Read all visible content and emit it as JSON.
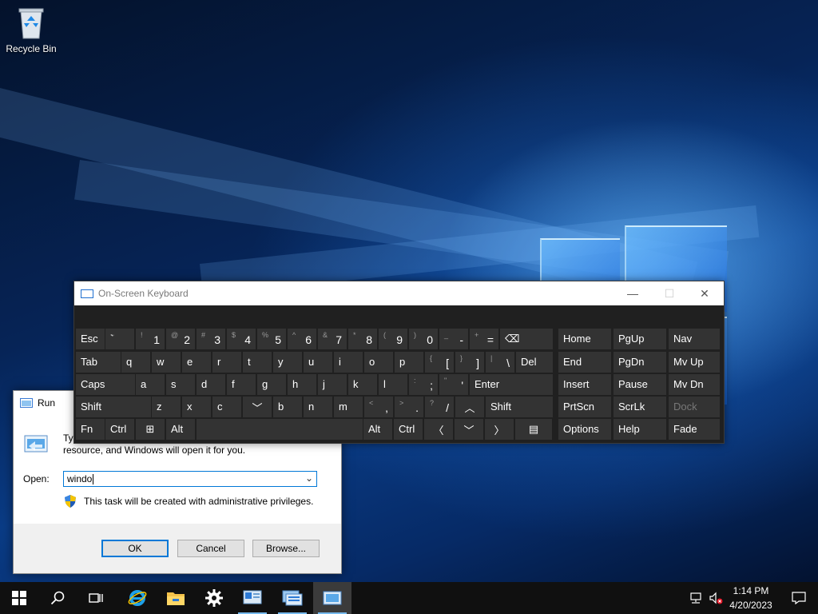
{
  "desktop": {
    "icons": [
      {
        "label": "Recycle Bin",
        "icon": "recycle-bin-icon"
      }
    ]
  },
  "run_dialog": {
    "title": "Run",
    "description": "Type the name of a program, folder, document, or Internet resource, and Windows will open it for you.",
    "description_visible_line1": "Typ",
    "description_line2": "resource, and Windows will open it for you.",
    "open_label": "Open:",
    "open_value": "windo",
    "admin_note": "This task will be created with administrative privileges.",
    "ok_label": "OK",
    "cancel_label": "Cancel",
    "browse_label": "Browse..."
  },
  "osk": {
    "title": "On-Screen Keyboard",
    "rows": [
      [
        {
          "main": "Esc"
        },
        {
          "sub": "~",
          "main": "`"
        },
        {
          "sub": "!",
          "big": "1"
        },
        {
          "sub": "@",
          "big": "2"
        },
        {
          "sub": "#",
          "big": "3"
        },
        {
          "sub": "$",
          "big": "4"
        },
        {
          "sub": "%",
          "big": "5"
        },
        {
          "sub": "^",
          "big": "6"
        },
        {
          "sub": "&",
          "big": "7"
        },
        {
          "sub": "*",
          "big": "8"
        },
        {
          "sub": "(",
          "big": "9"
        },
        {
          "sub": ")",
          "big": "0"
        },
        {
          "sub": "_",
          "big": "-"
        },
        {
          "sub": "+",
          "big": "="
        },
        {
          "main": "⌫"
        }
      ],
      [
        {
          "main": "Tab"
        },
        {
          "main": "q"
        },
        {
          "main": "w"
        },
        {
          "main": "e"
        },
        {
          "main": "r"
        },
        {
          "main": "t"
        },
        {
          "main": "y"
        },
        {
          "main": "u"
        },
        {
          "main": "i"
        },
        {
          "main": "o"
        },
        {
          "main": "p"
        },
        {
          "sub": "{",
          "big": "["
        },
        {
          "sub": "}",
          "big": "]"
        },
        {
          "sub": "|",
          "big": "\\"
        },
        {
          "main": "Del"
        }
      ],
      [
        {
          "main": "Caps"
        },
        {
          "main": "a"
        },
        {
          "main": "s"
        },
        {
          "main": "d"
        },
        {
          "main": "f"
        },
        {
          "main": "g"
        },
        {
          "main": "h"
        },
        {
          "main": "j"
        },
        {
          "main": "k"
        },
        {
          "main": "l"
        },
        {
          "sub": ":",
          "big": ";"
        },
        {
          "sub": "\"",
          "big": "'"
        },
        {
          "main": "Enter"
        }
      ],
      [
        {
          "main": "Shift"
        },
        {
          "main": "z"
        },
        {
          "main": "x"
        },
        {
          "main": "c"
        },
        {
          "main": "v"
        },
        {
          "main": "b"
        },
        {
          "main": "n"
        },
        {
          "main": "m"
        },
        {
          "sub": "<",
          "big": ","
        },
        {
          "sub": ">",
          "big": "."
        },
        {
          "sub": "?",
          "big": "/"
        },
        {
          "main": "^"
        },
        {
          "main": "Shift"
        }
      ],
      [
        {
          "main": "Fn"
        },
        {
          "main": "Ctrl"
        },
        {
          "main": "⊞"
        },
        {
          "main": "Alt"
        },
        {
          "main": ""
        },
        {
          "main": "Alt"
        },
        {
          "main": "Ctrl"
        },
        {
          "main": "<"
        },
        {
          "main": "v"
        },
        {
          "main": ">"
        },
        {
          "main": "▤"
        }
      ]
    ],
    "nav_rows": [
      [
        "Home",
        "PgUp",
        "Nav"
      ],
      [
        "End",
        "PgDn",
        "Mv Up"
      ],
      [
        "Insert",
        "Pause",
        "Mv Dn"
      ],
      [
        "PrtScn",
        "ScrLk",
        "Dock"
      ],
      [
        "Options",
        "Help",
        "Fade"
      ]
    ],
    "window_buttons": [
      "—",
      "☐",
      "✕"
    ]
  },
  "taskbar": {
    "items": [
      "start-icon",
      "search-icon",
      "task-view-icon",
      "internet-explorer-icon",
      "file-explorer-icon",
      "settings-icon",
      "server-manager-icon",
      "remote-desktop-icon",
      "run-icon"
    ],
    "time": "1:14 PM",
    "date": "4/20/2023"
  }
}
